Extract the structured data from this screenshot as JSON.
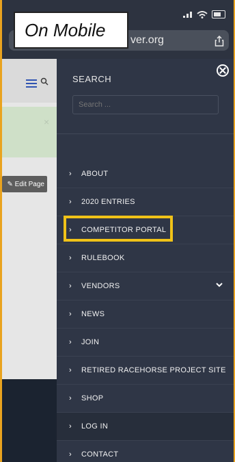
{
  "annotation": {
    "label": "On Mobile"
  },
  "browser": {
    "url_partial": "ver.org"
  },
  "page": {
    "edit_button": "✎ Edit Page",
    "alert_close": "×"
  },
  "menu": {
    "search_title": "SEARCH",
    "search_placeholder": "Search ...",
    "items": [
      {
        "label": "ABOUT"
      },
      {
        "label": "2020 ENTRIES"
      },
      {
        "label": "COMPETITOR PORTAL"
      },
      {
        "label": "RULEBOOK"
      },
      {
        "label": "VENDORS"
      },
      {
        "label": "NEWS"
      },
      {
        "label": "JOIN"
      },
      {
        "label": "RETIRED RACEHORSE PROJECT SITE"
      },
      {
        "label": "SHOP"
      },
      {
        "label": "LOG IN"
      },
      {
        "label": "CONTACT"
      }
    ]
  },
  "colors": {
    "highlight": "#f0c218",
    "menu_bg": "#2f3646",
    "border": "#e9a31f"
  }
}
